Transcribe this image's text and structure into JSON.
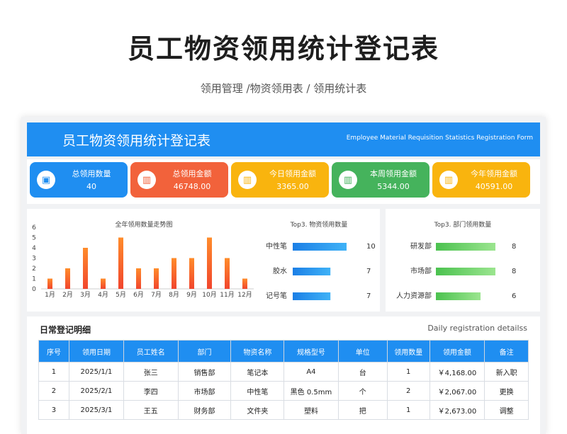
{
  "header": {
    "title": "员工物资领用统计登记表",
    "subtitle": "领用管理 /物资领用表 / 领用统计表"
  },
  "banner": {
    "title": "员工物资领用统计登记表",
    "subtitle_en": "Employee Material Requisition Statistics Registration Form"
  },
  "kpis": [
    {
      "label": "总领用数量",
      "value": "40",
      "color": "#1f8ef1",
      "icon": "briefcase-icon"
    },
    {
      "label": "总领用金额",
      "value": "46748.00",
      "color": "#f2623b",
      "icon": "bar-chart-icon"
    },
    {
      "label": "今日领用金额",
      "value": "3365.00",
      "color": "#f9b40e",
      "icon": "bar-chart-icon"
    },
    {
      "label": "本周领用金额",
      "value": "5344.00",
      "color": "#45b35c",
      "icon": "bar-chart-icon"
    },
    {
      "label": "今年领用金额",
      "value": "40591.00",
      "color": "#f9b40e",
      "icon": "bar-chart-icon"
    }
  ],
  "chart_data": [
    {
      "type": "bar",
      "title": "全年领用数量走势图",
      "categories": [
        "1月",
        "2月",
        "3月",
        "4月",
        "5月",
        "6月",
        "7月",
        "8月",
        "9月",
        "10月",
        "11月",
        "12月"
      ],
      "values": [
        1,
        2,
        4,
        1,
        5,
        2,
        2,
        3,
        3,
        5,
        3,
        1
      ],
      "ylim": [
        0,
        6
      ],
      "yticks": [
        "6",
        "5",
        "4",
        "3",
        "2",
        "1",
        "0"
      ],
      "bar_color": "#f4622d"
    },
    {
      "type": "bar",
      "orientation": "horizontal",
      "title": "Top3. 物资领用数量",
      "categories": [
        "中性笔",
        "胶水",
        "记号笔"
      ],
      "values": [
        10,
        7,
        7
      ],
      "bar_color": "#1f8ef1"
    },
    {
      "type": "bar",
      "orientation": "horizontal",
      "title": "Top3. 部门领用数量",
      "categories": [
        "研发部",
        "市场部",
        "人力资源部"
      ],
      "values": [
        8,
        8,
        6
      ],
      "bar_color": "#6fd26a"
    }
  ],
  "detail": {
    "title": "日常登记明细",
    "title_en": "Daily registration detailss",
    "columns": [
      "序号",
      "领用日期",
      "员工姓名",
      "部门",
      "物资名称",
      "规格型号",
      "单位",
      "领用数量",
      "领用金额",
      "备注"
    ],
    "rows": [
      [
        "1",
        "2025/1/1",
        "张三",
        "销售部",
        "笔记本",
        "A4",
        "台",
        "1",
        "￥4,168.00",
        "新入职"
      ],
      [
        "2",
        "2025/2/1",
        "李四",
        "市场部",
        "中性笔",
        "黑色 0.5mm",
        "个",
        "2",
        "￥2,067.00",
        "更换"
      ],
      [
        "3",
        "2025/3/1",
        "王五",
        "财务部",
        "文件夹",
        "塑料",
        "把",
        "1",
        "￥2,673.00",
        "调整"
      ]
    ]
  }
}
